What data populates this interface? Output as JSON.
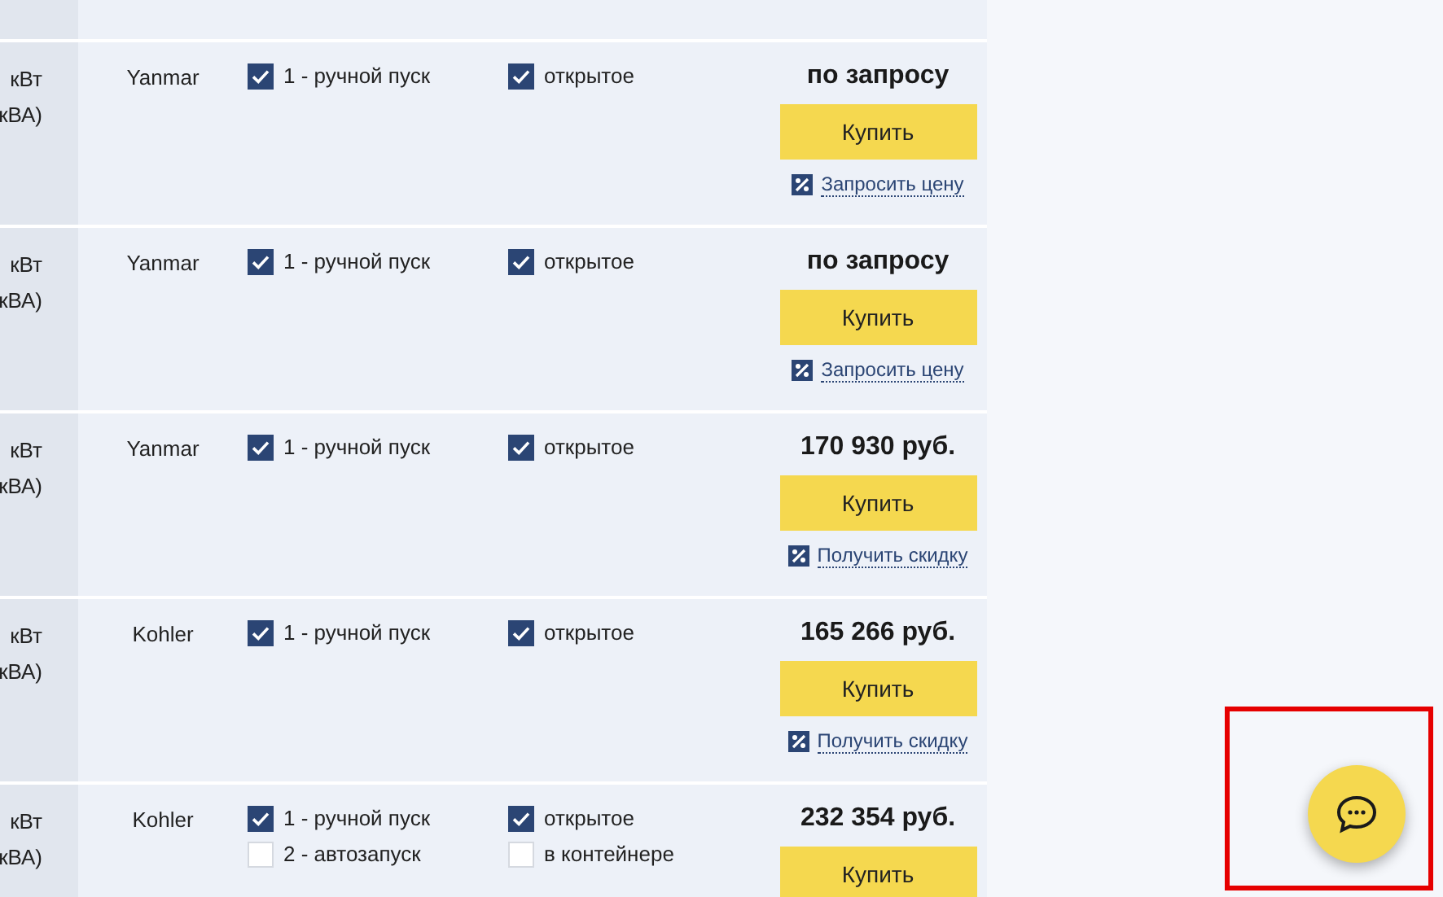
{
  "rows": [
    {
      "power": [
        "кВт",
        "кВА)"
      ],
      "brand": "Yanmar",
      "start_options": [
        {
          "label": "1 - ручной пуск",
          "checked": true
        }
      ],
      "body_options": [
        {
          "label": "открытое",
          "checked": true
        }
      ],
      "price": "по запросу",
      "buy": "Купить",
      "link": "Запросить цену"
    },
    {
      "power": [
        "кВт",
        "кВА)"
      ],
      "brand": "Yanmar",
      "start_options": [
        {
          "label": "1 - ручной пуск",
          "checked": true
        }
      ],
      "body_options": [
        {
          "label": "открытое",
          "checked": true
        }
      ],
      "price": "по запросу",
      "buy": "Купить",
      "link": "Запросить цену"
    },
    {
      "power": [
        "кВт",
        "кВА)"
      ],
      "brand": "Yanmar",
      "start_options": [
        {
          "label": "1 - ручной пуск",
          "checked": true
        }
      ],
      "body_options": [
        {
          "label": "открытое",
          "checked": true
        }
      ],
      "price": "170 930 руб.",
      "buy": "Купить",
      "link": "Получить скидку"
    },
    {
      "power": [
        "кВт",
        "кВА)"
      ],
      "brand": "Kohler",
      "start_options": [
        {
          "label": "1 - ручной пуск",
          "checked": true
        }
      ],
      "body_options": [
        {
          "label": "открытое",
          "checked": true
        }
      ],
      "price": "165 266 руб.",
      "buy": "Купить",
      "link": "Получить скидку"
    },
    {
      "power": [
        "кВт",
        "кВА)"
      ],
      "brand": "Kohler",
      "start_options": [
        {
          "label": "1 - ручной пуск",
          "checked": true
        },
        {
          "label": "2 - автозапуск",
          "checked": false
        }
      ],
      "body_options": [
        {
          "label": "открытое",
          "checked": true
        },
        {
          "label": "в контейнере",
          "checked": false
        }
      ],
      "price": "232 354 руб.",
      "buy": "Купить"
    }
  ]
}
